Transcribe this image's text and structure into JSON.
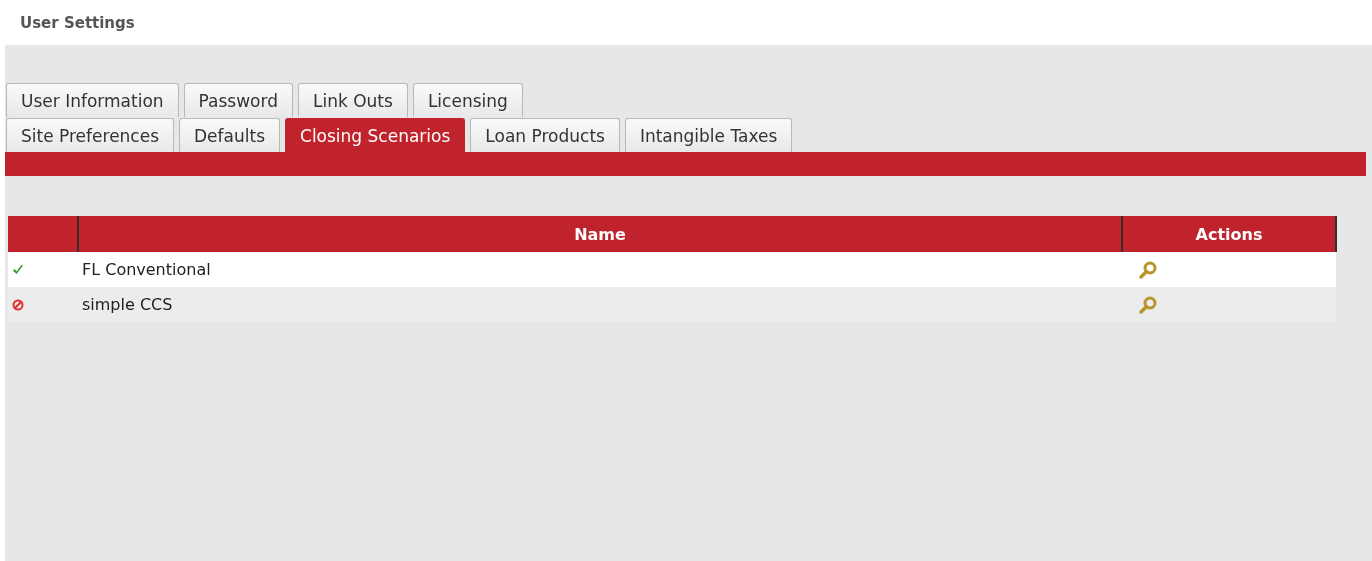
{
  "page": {
    "title": "User Settings"
  },
  "tab_rows": [
    [
      {
        "label": "User Information",
        "selected": false
      },
      {
        "label": "Password",
        "selected": false
      },
      {
        "label": "Link Outs",
        "selected": false
      },
      {
        "label": "Licensing",
        "selected": false
      }
    ],
    [
      {
        "label": "Site Preferences",
        "selected": false
      },
      {
        "label": "Defaults",
        "selected": false
      },
      {
        "label": "Closing Scenarios",
        "selected": true
      },
      {
        "label": "Loan Products",
        "selected": false
      },
      {
        "label": "Intangible Taxes",
        "selected": false
      }
    ]
  ],
  "table": {
    "columns": [
      "Name",
      "Actions"
    ],
    "rows": [
      {
        "kind": "active",
        "name": "FL Conventional"
      },
      {
        "kind": "disabled",
        "name": "simple CCS"
      }
    ]
  }
}
